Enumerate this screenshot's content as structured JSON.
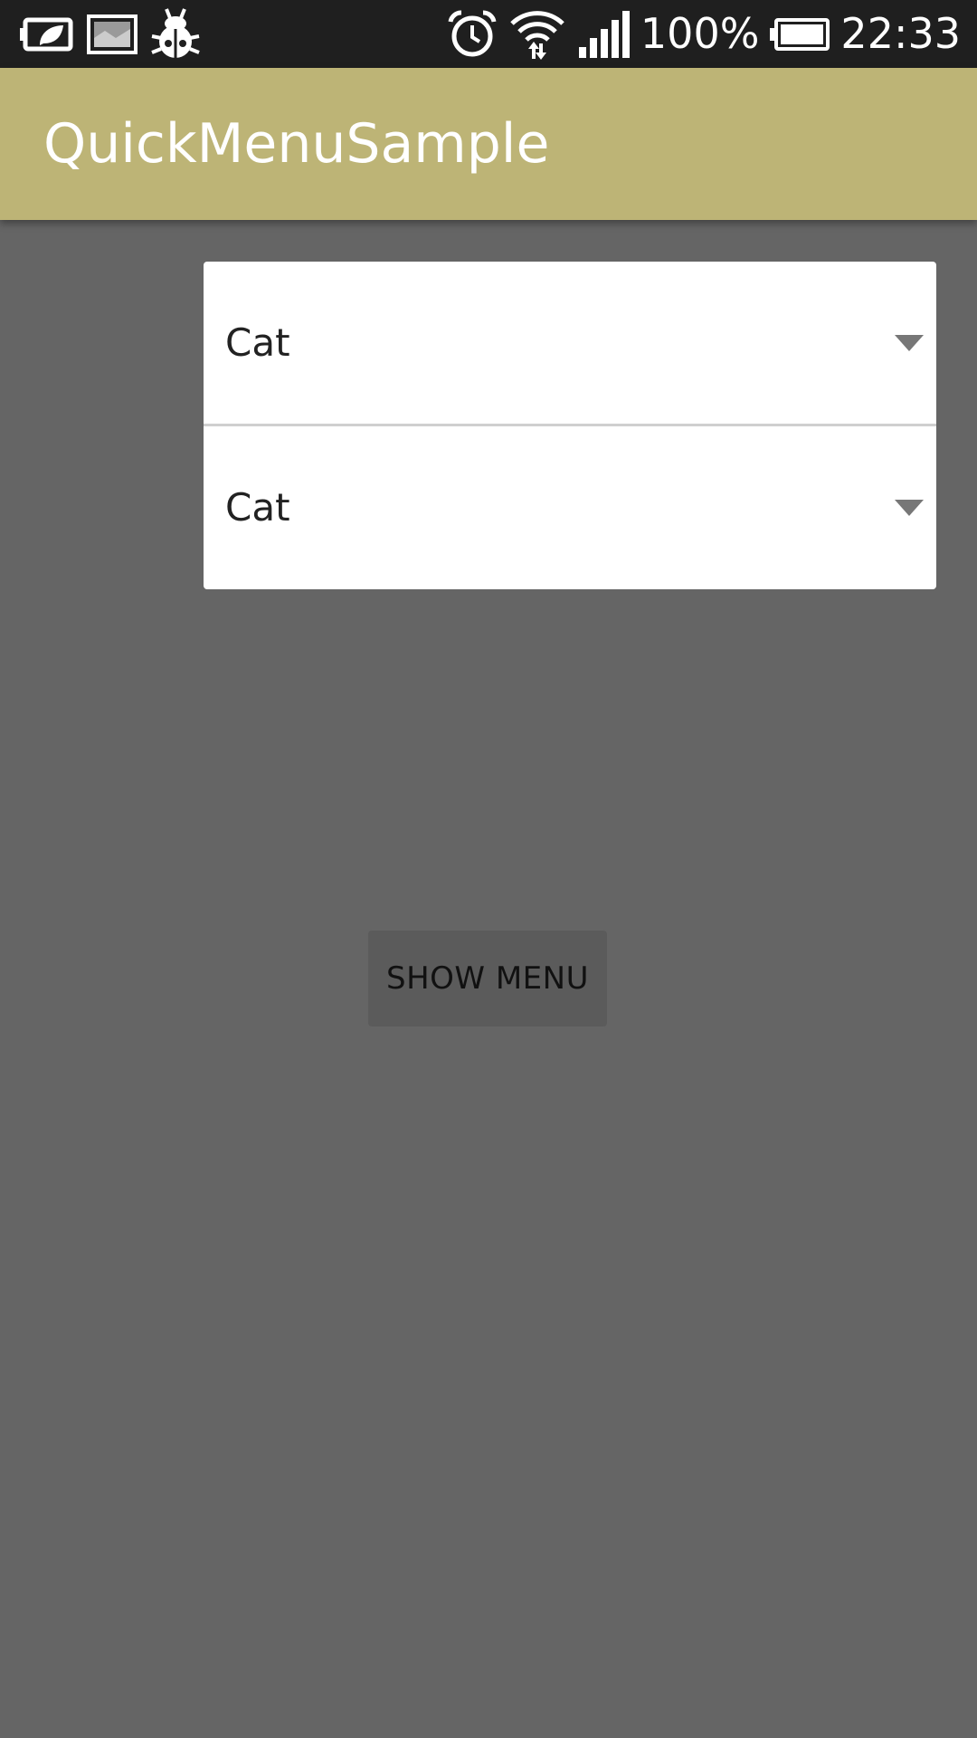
{
  "status_bar": {
    "left_icons": [
      "battery-saver-icon",
      "image-icon",
      "bug-icon"
    ],
    "right_icons": [
      "alarm-icon",
      "wifi-icon",
      "signal-icon",
      "battery-icon"
    ],
    "battery_percent": "100%",
    "time": "22:33"
  },
  "app_bar": {
    "title": "QuickMenuSample",
    "color": "#bdb476"
  },
  "dropdowns": [
    {
      "value": "Cat",
      "icon": "dropdown-arrow-icon"
    },
    {
      "value": "Cat",
      "icon": "dropdown-arrow-icon"
    }
  ],
  "main": {
    "show_menu_label": "SHOW MENU",
    "background": "#656565"
  }
}
